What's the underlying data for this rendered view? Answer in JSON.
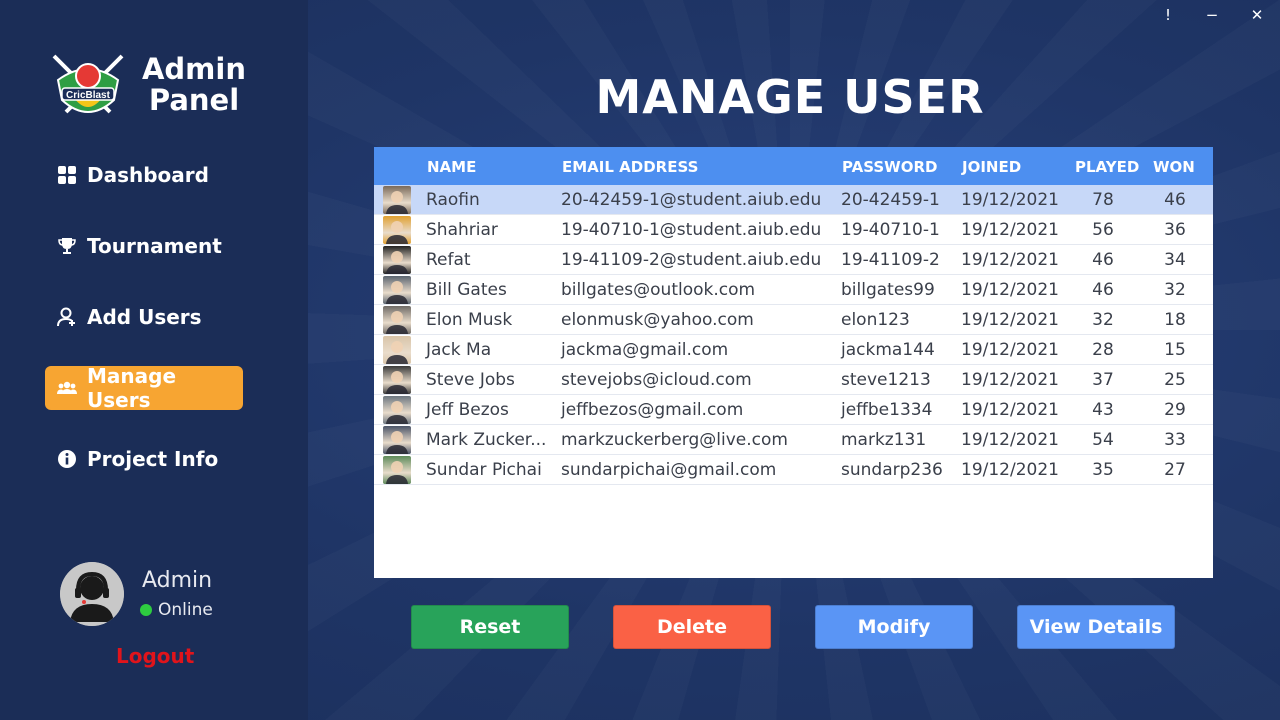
{
  "window": {
    "controls": [
      "!",
      "−",
      "✕"
    ]
  },
  "brand": {
    "logo_text": "CricBlast",
    "title_line1": "Admin",
    "title_line2": "Panel"
  },
  "nav": [
    {
      "label": "Dashboard",
      "icon": "grid-icon",
      "active": false
    },
    {
      "label": "Tournament",
      "icon": "trophy-icon",
      "active": false
    },
    {
      "label": "Add Users",
      "icon": "add-user-icon",
      "active": false
    },
    {
      "label": "Manage Users",
      "icon": "users-icon",
      "active": true
    },
    {
      "label": "Project Info",
      "icon": "info-icon",
      "active": false
    }
  ],
  "user": {
    "name": "Admin",
    "status": "Online",
    "logout_label": "Logout"
  },
  "page": {
    "title": "MANAGE USER"
  },
  "table": {
    "headers": [
      "NAME",
      "EMAIL ADDRESS",
      "PASSWORD",
      "JOINED",
      "PLAYED",
      "WON"
    ],
    "rows": [
      {
        "name": "Raofin",
        "email": "20-42459-1@student.aiub.edu",
        "password": "20-42459-1",
        "joined": "19/12/2021",
        "played": "78",
        "won": "46",
        "selected": true,
        "thumb_color": "#7a6a5a"
      },
      {
        "name": "Shahriar",
        "email": "19-40710-1@student.aiub.edu",
        "password": "19-40710-1",
        "joined": "19/12/2021",
        "played": "56",
        "won": "36",
        "thumb_color": "#e0a030"
      },
      {
        "name": "Refat",
        "email": "19-41109-2@student.aiub.edu",
        "password": "19-41109-2",
        "joined": "19/12/2021",
        "played": "46",
        "won": "34",
        "thumb_color": "#222222"
      },
      {
        "name": "Bill Gates",
        "email": "billgates@outlook.com",
        "password": "billgates99",
        "joined": "19/12/2021",
        "played": "46",
        "won": "32",
        "thumb_color": "#5a6470"
      },
      {
        "name": "Elon Musk",
        "email": "elonmusk@yahoo.com",
        "password": "elon123",
        "joined": "19/12/2021",
        "played": "32",
        "won": "18",
        "thumb_color": "#6e6a66"
      },
      {
        "name": "Jack Ma",
        "email": "jackma@gmail.com",
        "password": "jackma144",
        "joined": "19/12/2021",
        "played": "28",
        "won": "15",
        "thumb_color": "#d8c4a8"
      },
      {
        "name": "Steve Jobs",
        "email": "stevejobs@icloud.com",
        "password": "steve1213",
        "joined": "19/12/2021",
        "played": "37",
        "won": "25",
        "thumb_color": "#3a3a3a"
      },
      {
        "name": "Jeff Bezos",
        "email": "jeffbezos@gmail.com",
        "password": "jeffbe1334",
        "joined": "19/12/2021",
        "played": "43",
        "won": "29",
        "thumb_color": "#6c7680"
      },
      {
        "name": "Mark Zucker...",
        "email": "markzuckerberg@live.com",
        "password": "markz131",
        "joined": "19/12/2021",
        "played": "54",
        "won": "33",
        "thumb_color": "#4a5468"
      },
      {
        "name": "Sundar Pichai",
        "email": "sundarpichai@gmail.com",
        "password": "sundarp236",
        "joined": "19/12/2021",
        "played": "35",
        "won": "27",
        "thumb_color": "#5d8a5a"
      }
    ]
  },
  "actions": [
    {
      "label": "Reset",
      "color": "#28a35a"
    },
    {
      "label": "Delete",
      "color": "#fa6145"
    },
    {
      "label": "Modify",
      "color": "#5a95f5"
    },
    {
      "label": "View Details",
      "color": "#5a95f5"
    }
  ],
  "colors": {
    "accent": "#f7a532",
    "header": "#4d8ff0",
    "selected_row": "#c7d8f8",
    "logout": "#e0141b"
  }
}
